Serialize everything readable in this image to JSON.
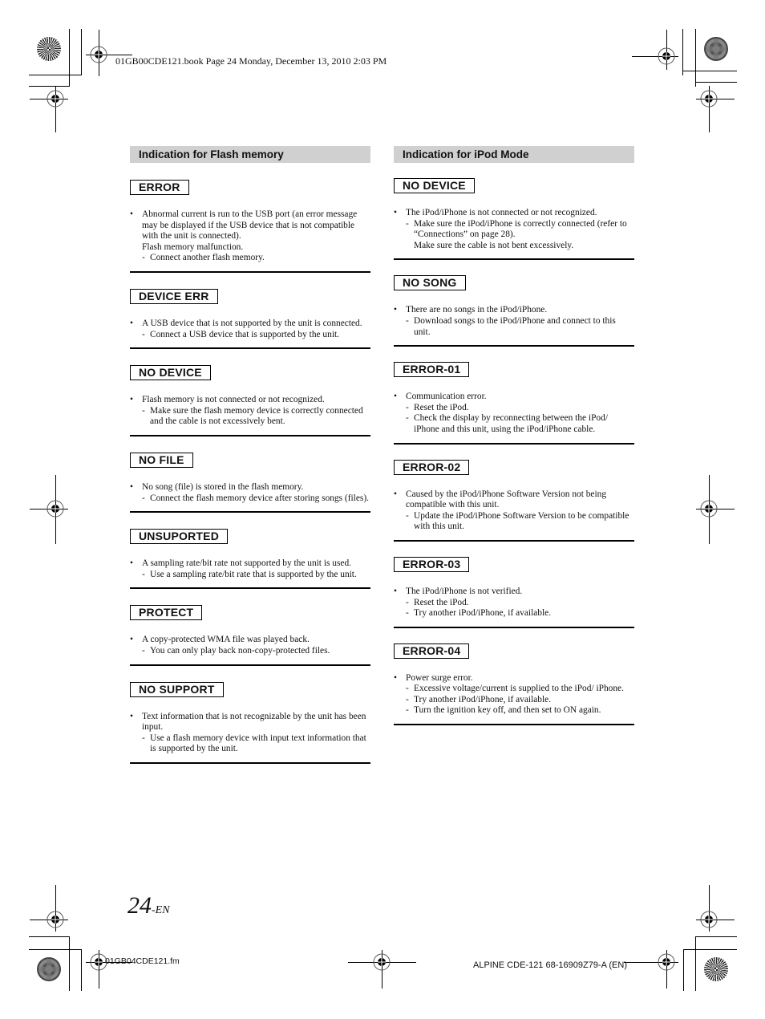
{
  "header": {
    "book_line": "01GB00CDE121.book  Page 24  Monday, December 13, 2010  2:03 PM"
  },
  "left_column": {
    "title": "Indication for Flash memory",
    "entries": [
      {
        "code": "ERROR",
        "cause": "Abnormal current is run to the USB port (an error message may be displayed if the USB device that is not compatible with the unit is connected).",
        "cause_extra": "Flash memory malfunction.",
        "remedies": [
          "Connect another flash memory."
        ]
      },
      {
        "code": "DEVICE ERR",
        "cause": "A USB device that is not supported by the unit is connected.",
        "remedies": [
          "Connect a USB device that is supported by the unit."
        ]
      },
      {
        "code": "NO DEVICE",
        "cause": "Flash memory is not connected or not recognized.",
        "remedies": [
          "Make sure the flash memory device is correctly connected and the cable is not excessively bent."
        ]
      },
      {
        "code": "NO FILE",
        "cause": "No song (file) is stored in the flash memory.",
        "remedies": [
          "Connect the flash memory device after storing songs (files)."
        ]
      },
      {
        "code": "UNSUPORTED",
        "cause": "A sampling rate/bit rate not supported by the unit is used.",
        "remedies": [
          "Use a sampling rate/bit rate that is supported by the unit."
        ]
      },
      {
        "code": "PROTECT",
        "cause": "A copy-protected WMA file was played back.",
        "remedies": [
          "You can only play back non-copy-protected files."
        ]
      },
      {
        "code": "NO SUPPORT",
        "cause": "Text information that is not recognizable by the unit has been input.",
        "remedies": [
          "Use a flash memory device with input text information that is supported by the unit."
        ]
      }
    ]
  },
  "right_column": {
    "title": "Indication for iPod Mode",
    "entries": [
      {
        "code": "NO DEVICE",
        "cause": "The iPod/iPhone is not connected or not recognized.",
        "remedies": [
          "Make sure the iPod/iPhone is correctly connected (refer to “Connections” on page 28).\nMake sure the cable is not bent excessively."
        ]
      },
      {
        "code": "NO SONG",
        "cause": "There are no songs in the iPod/iPhone.",
        "remedies": [
          "Download songs to the iPod/iPhone and connect to this unit."
        ]
      },
      {
        "code": "ERROR-01",
        "cause": "Communication error.",
        "remedies": [
          "Reset the iPod.",
          "Check the display by reconnecting between the iPod/ iPhone and this unit, using the iPod/iPhone cable."
        ]
      },
      {
        "code": "ERROR-02",
        "cause": "Caused by the iPod/iPhone Software Version not being compatible with this unit.",
        "remedies": [
          "Update the iPod/iPhone Software Version to be compatible with this unit."
        ]
      },
      {
        "code": "ERROR-03",
        "cause": "The iPod/iPhone is not verified.",
        "remedies": [
          "Reset the iPod.",
          "Try another iPod/iPhone, if available."
        ]
      },
      {
        "code": "ERROR-04",
        "cause": "Power surge error.",
        "remedies": [
          "Excessive voltage/current is supplied to the iPod/ iPhone.",
          "Try another iPod/iPhone, if available.",
          "Turn the ignition key off, and then set to ON again."
        ]
      }
    ]
  },
  "footer": {
    "page_number": "24",
    "page_suffix": "-EN",
    "file_name": "01GB04CDE121.fm",
    "model_line": "ALPINE CDE-121 68-16909Z79-A (EN)"
  },
  "symbols": {
    "bullet": "•",
    "dash": "-"
  }
}
